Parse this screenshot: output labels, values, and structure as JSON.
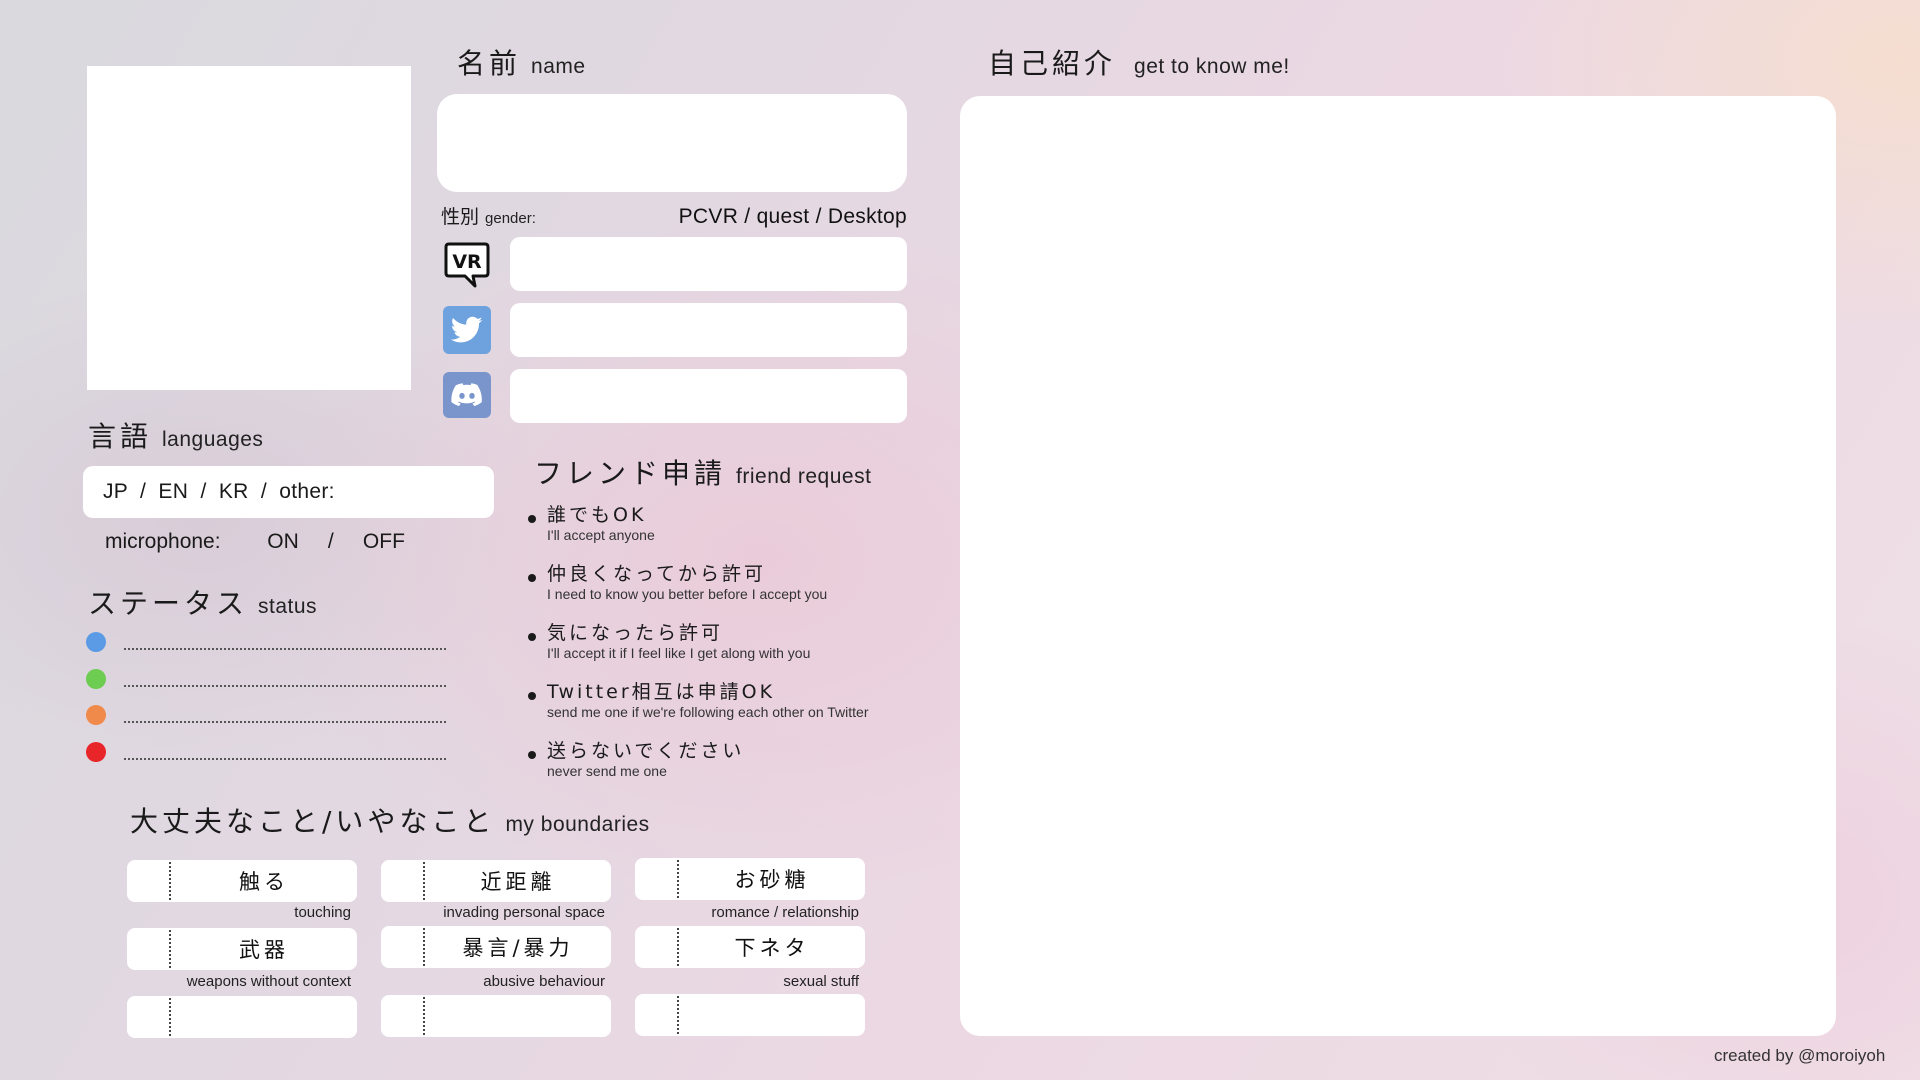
{
  "name_section": {
    "jp": "名前",
    "en": "name"
  },
  "intro_section": {
    "jp": "自己紹介",
    "en": "get to know me!"
  },
  "gender": {
    "jp": "性別",
    "en": "gender:"
  },
  "platform_text": "PCVR / quest / Desktop",
  "social_icons": {
    "vr": "vrchat-icon",
    "twitter": "twitter-icon",
    "discord": "discord-icon",
    "vr_label": "VR"
  },
  "languages": {
    "jp": "言語",
    "en": "languages",
    "options": "JP  /  EN  /  KR  /  other:",
    "microphone": "microphone:        ON     /     OFF"
  },
  "status": {
    "jp": "ステータス",
    "en": "status",
    "colors": [
      "#5b9be6",
      "#6dcc52",
      "#f08a4b",
      "#e8262a"
    ]
  },
  "friend_request": {
    "jp": "フレンド申請",
    "en": "friend request",
    "items": [
      {
        "jp": "誰でもOK",
        "en": "I'll accept anyone"
      },
      {
        "jp": "仲良くなってから許可",
        "en": "I need to know you better before I accept you"
      },
      {
        "jp": "気になったら許可",
        "en": "I'll accept it if I feel like I get along with you"
      },
      {
        "jp": "Twitter相互は申請OK",
        "en": "send me one if we're following each other on Twitter"
      },
      {
        "jp": "送らないでください",
        "en": "never send me one"
      }
    ]
  },
  "boundaries": {
    "jp": "大丈夫なこと/いやなこと",
    "en": "my boundaries",
    "items": [
      {
        "jp": "触る",
        "en": "touching"
      },
      {
        "jp": "近距離",
        "en": "invading personal space"
      },
      {
        "jp": "お砂糖",
        "en": "romance / relationship"
      },
      {
        "jp": "武器",
        "en": "weapons without context"
      },
      {
        "jp": "暴言/暴力",
        "en": "abusive behaviour"
      },
      {
        "jp": "下ネタ",
        "en": "sexual stuff"
      },
      {
        "jp": "",
        "en": ""
      },
      {
        "jp": "",
        "en": ""
      },
      {
        "jp": "",
        "en": ""
      }
    ]
  },
  "credit": "created by @moroiyoh"
}
